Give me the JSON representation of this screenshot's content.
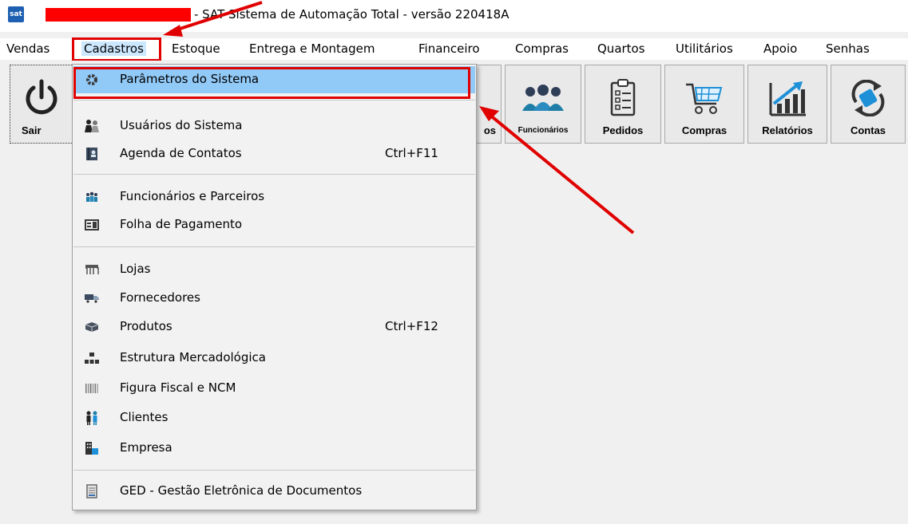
{
  "window": {
    "title": "- SAT Sistema de Automação Total - versão 220418A",
    "logo_text": "sat",
    "logo_icon": "sat-logo-icon"
  },
  "menubar": {
    "items": [
      {
        "label": "Vendas"
      },
      {
        "label": "Cadastros"
      },
      {
        "label": "Estoque"
      },
      {
        "label": "Entrega e Montagem"
      },
      {
        "label": "Financeiro"
      },
      {
        "label": "Compras"
      },
      {
        "label": "Quartos"
      },
      {
        "label": "Utilitários"
      },
      {
        "label": "Apoio"
      },
      {
        "label": "Senhas"
      }
    ],
    "open_item": "Cadastros"
  },
  "toolbar": {
    "buttons": [
      {
        "label": "Sair",
        "icon": "power-icon"
      },
      {
        "label": "os",
        "icon": "hidden-icon"
      },
      {
        "label": "Funcionários",
        "icon": "team-icon"
      },
      {
        "label": "Pedidos",
        "icon": "clipboard-list-icon"
      },
      {
        "label": "Compras",
        "icon": "shopping-cart-icon"
      },
      {
        "label": "Relatórios",
        "icon": "bar-chart-icon"
      },
      {
        "label": "Contas",
        "icon": "money-cycle-icon"
      }
    ]
  },
  "dropdown": {
    "items": [
      {
        "label": "Parâmetros do Sistema",
        "icon": "gear-icon",
        "shortcut": ""
      },
      {
        "label": "Usuários do Sistema",
        "icon": "users-icon",
        "shortcut": ""
      },
      {
        "label": "Agenda de Contatos",
        "icon": "address-book-icon",
        "shortcut": "Ctrl+F11"
      },
      {
        "label": "Funcionários e Parceiros",
        "icon": "team-icon",
        "shortcut": ""
      },
      {
        "label": "Folha de Pagamento",
        "icon": "payroll-icon",
        "shortcut": ""
      },
      {
        "label": "Lojas",
        "icon": "store-icon",
        "shortcut": ""
      },
      {
        "label": "Fornecedores",
        "icon": "truck-icon",
        "shortcut": ""
      },
      {
        "label": "Produtos",
        "icon": "box-icon",
        "shortcut": "Ctrl+F12"
      },
      {
        "label": "Estrutura Mercadológica",
        "icon": "hierarchy-icon",
        "shortcut": ""
      },
      {
        "label": "Figura Fiscal e NCM",
        "icon": "barcode-icon",
        "shortcut": ""
      },
      {
        "label": "Clientes",
        "icon": "clients-icon",
        "shortcut": ""
      },
      {
        "label": "Empresa",
        "icon": "building-icon",
        "shortcut": ""
      },
      {
        "label": "GED - Gestão Eletrônica de Documentos",
        "icon": "document-icon",
        "shortcut": ""
      }
    ]
  },
  "colors": {
    "highlight_red": "#e00000",
    "menu_hover": "#91c9f7",
    "background": "#f0f0f0"
  }
}
